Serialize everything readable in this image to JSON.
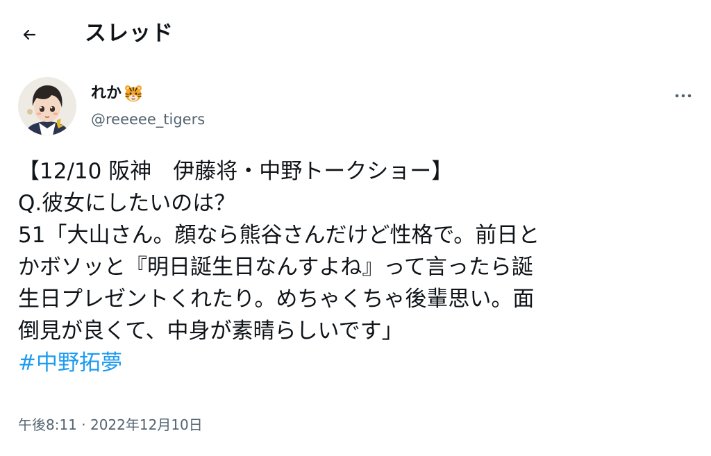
{
  "header": {
    "back_icon": "arrow-left-icon",
    "title": "スレッド"
  },
  "author": {
    "display_name": "れか",
    "name_emoji": "tiger-face-icon",
    "handle": "@reeeee_tigers",
    "avatar": "avatar-image"
  },
  "more_icon": "more-dots-icon",
  "tweet": {
    "lines": [
      "【12/10 阪神　伊藤将・中野トークショー】",
      "Q.彼女にしたいのは？",
      "51「大山さん。顔なら熊谷さんだけど性格で。前日と",
      "かボソッと『明日誕生日なんすよね』って言ったら誕",
      "生日プレゼントくれたり。めちゃくちゃ後輩思い。面",
      "倒見が良くて、中身が素晴らしいです」"
    ],
    "hashtag": "#中野拓夢",
    "timestamp": "午後8:11 · 2022年12月10日"
  },
  "colors": {
    "text": "#0f1419",
    "secondary": "#536471",
    "link": "#1d9bf0"
  }
}
